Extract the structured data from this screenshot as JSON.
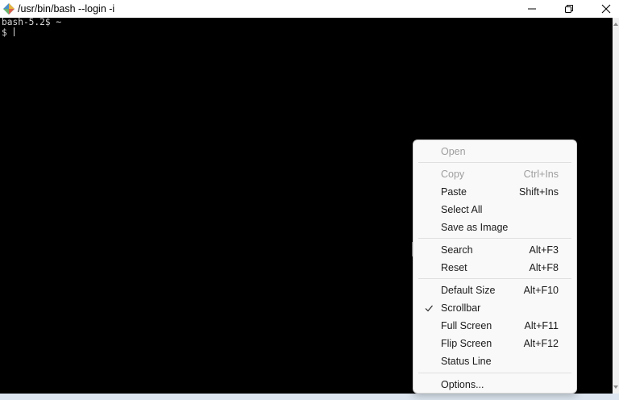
{
  "window": {
    "title": "/usr/bin/bash --login -i"
  },
  "terminal": {
    "lines": [
      "bash-5.2$ ~",
      "$ "
    ]
  },
  "menu": {
    "open": {
      "label": "Open",
      "enabled": false
    },
    "copy": {
      "label": "Copy",
      "shortcut": "Ctrl+Ins",
      "enabled": false
    },
    "paste": {
      "label": "Paste",
      "shortcut": "Shift+Ins"
    },
    "select_all": {
      "label": "Select All"
    },
    "save_image": {
      "label": "Save as Image"
    },
    "search": {
      "label": "Search",
      "shortcut": "Alt+F3"
    },
    "reset": {
      "label": "Reset",
      "shortcut": "Alt+F8"
    },
    "default_size": {
      "label": "Default Size",
      "shortcut": "Alt+F10"
    },
    "scrollbar": {
      "label": "Scrollbar",
      "checked": true
    },
    "full_screen": {
      "label": "Full Screen",
      "shortcut": "Alt+F11"
    },
    "flip_screen": {
      "label": "Flip Screen",
      "shortcut": "Alt+F12"
    },
    "status_line": {
      "label": "Status Line"
    },
    "options": {
      "label": "Options..."
    }
  },
  "colors": {
    "terminal_bg": "#000000",
    "terminal_fg": "#d8d8d8",
    "menu_bg": "#f9f9f9",
    "disabled_text": "#9e9e9e"
  },
  "icons": [
    "mintty-app-icon",
    "minimize-icon",
    "restore-icon",
    "close-icon",
    "check-icon",
    "mouse-pointer-icon"
  ]
}
